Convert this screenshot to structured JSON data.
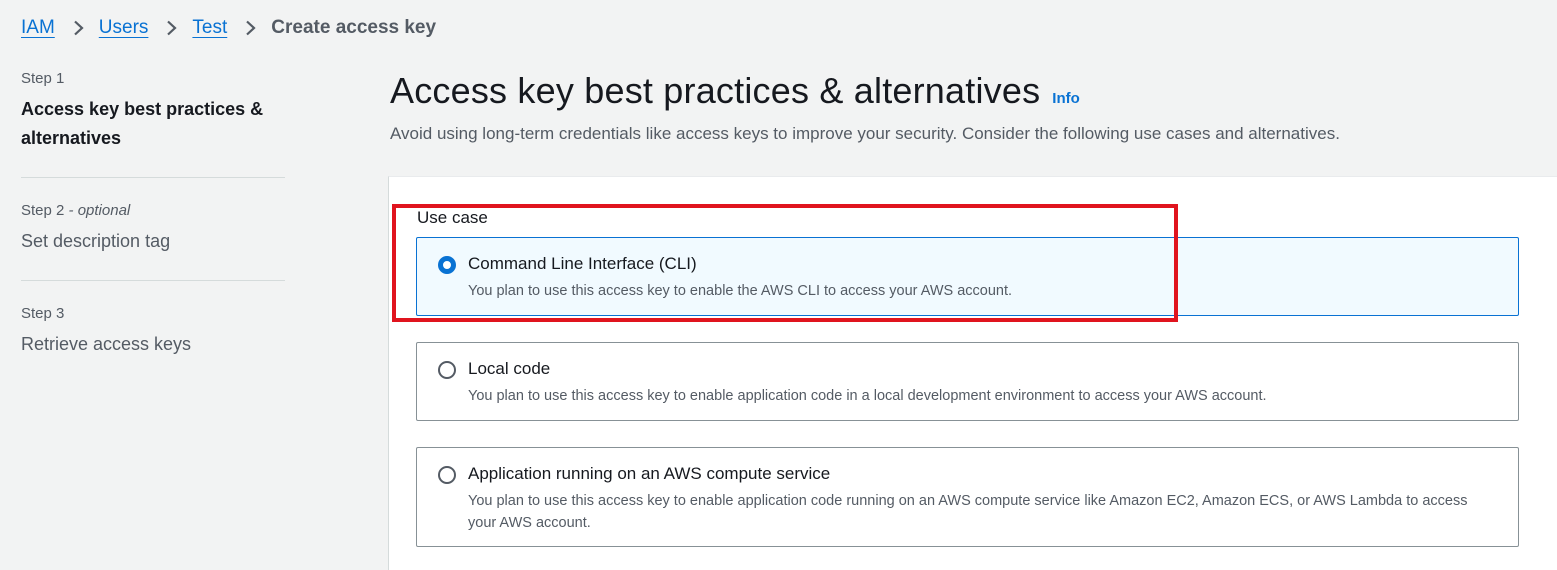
{
  "breadcrumb": {
    "items": [
      {
        "label": "IAM"
      },
      {
        "label": "Users"
      },
      {
        "label": "Test"
      }
    ],
    "current": "Create access key"
  },
  "steps": [
    {
      "number": "Step 1",
      "optional": "",
      "title": "Access key best practices & alternatives"
    },
    {
      "number": "Step 2",
      "optional": " - optional",
      "title": "Set description tag"
    },
    {
      "number": "Step 3",
      "optional": "",
      "title": "Retrieve access keys"
    }
  ],
  "header": {
    "title": "Access key best practices & alternatives",
    "info": "Info",
    "subtitle": "Avoid using long-term credentials like access keys to improve your security. Consider the following use cases and alternatives."
  },
  "use_case": {
    "label": "Use case",
    "options": [
      {
        "title": "Command Line Interface (CLI)",
        "description": "You plan to use this access key to enable the AWS CLI to access your AWS account.",
        "selected": true
      },
      {
        "title": "Local code",
        "description": "You plan to use this access key to enable application code in a local development environment to access your AWS account.",
        "selected": false
      },
      {
        "title": "Application running on an AWS compute service",
        "description": "You plan to use this access key to enable application code running on an AWS compute service like Amazon EC2, Amazon ECS, or AWS Lambda to access your AWS account.",
        "selected": false
      }
    ]
  },
  "colors": {
    "accent": "#0972d3",
    "highlight": "#e0141e",
    "selected_bg": "#f1faff"
  }
}
